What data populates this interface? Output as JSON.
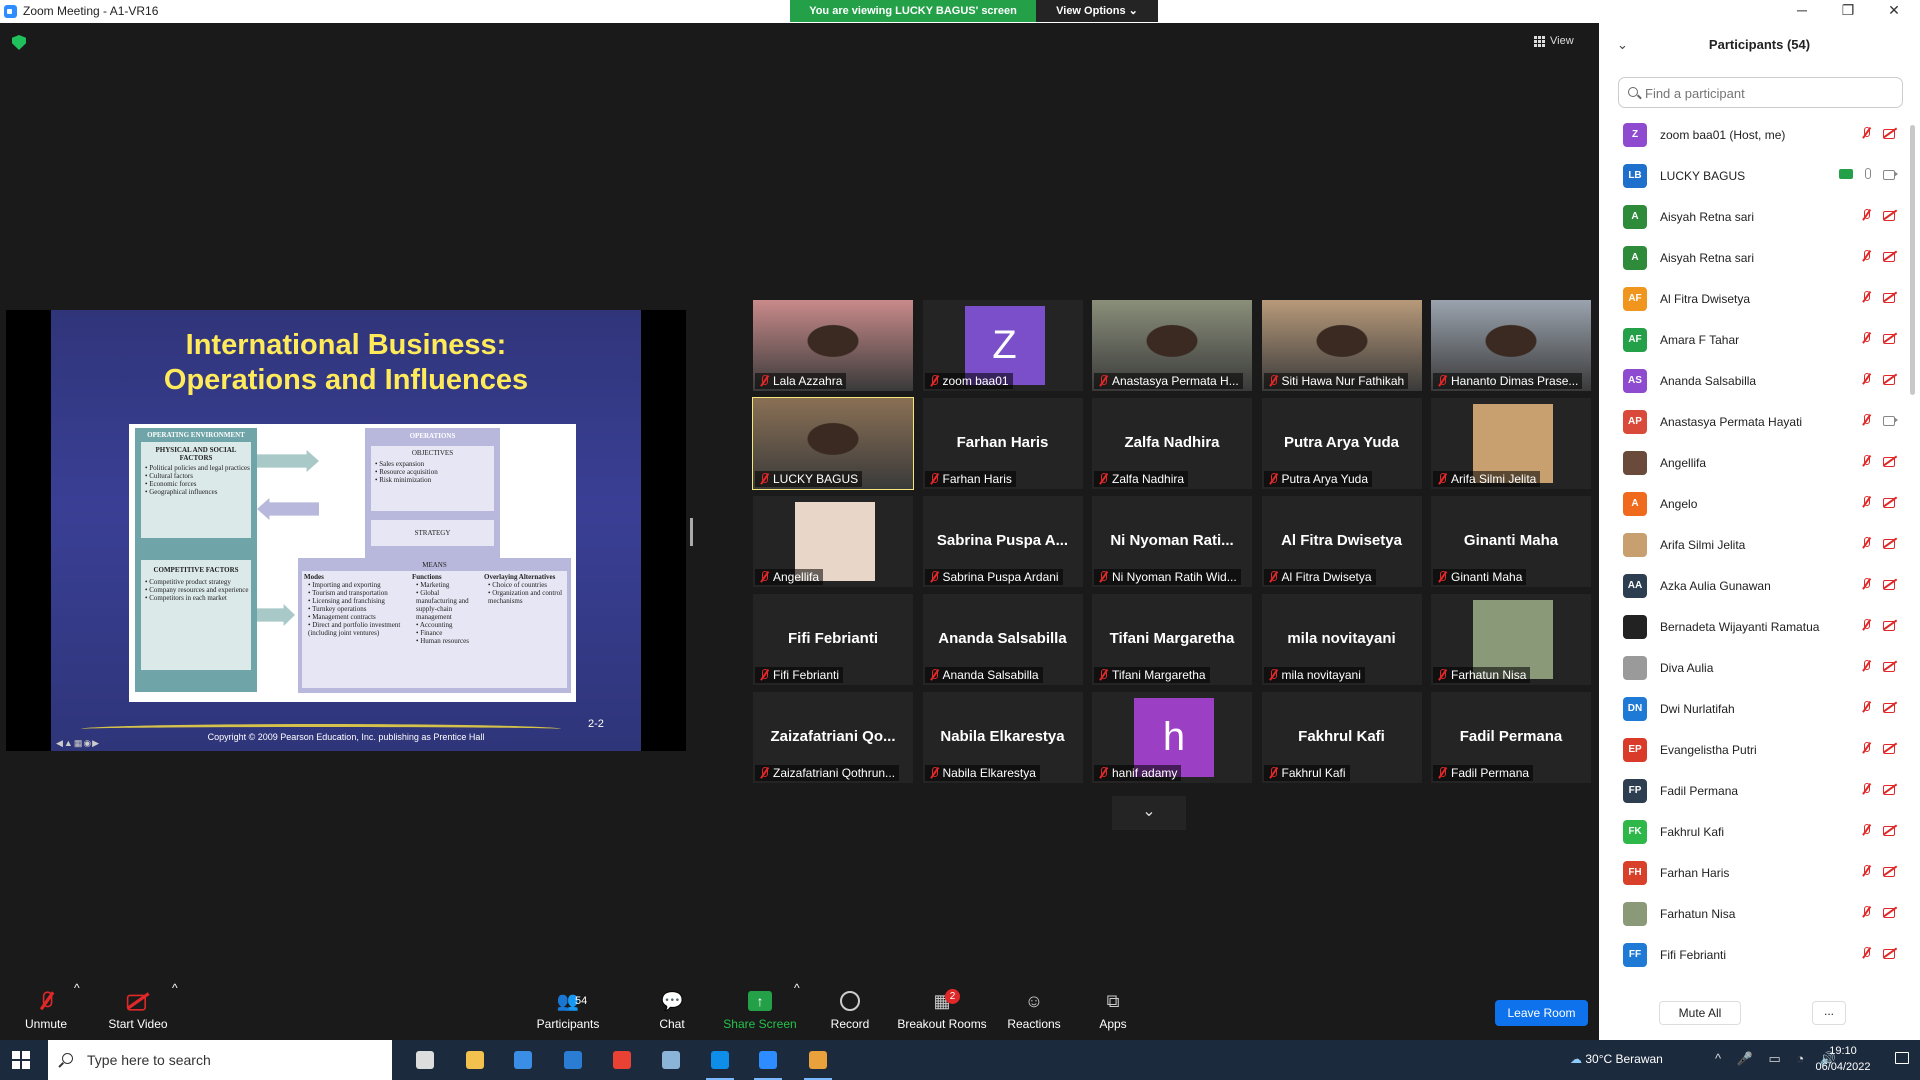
{
  "window": {
    "title": "Zoom Meeting - A1-VR16",
    "minimize": "─",
    "maximize": "❐",
    "close": "✕"
  },
  "banner": {
    "viewing": "You are viewing LUCKY BAGUS' screen",
    "view_options": "View Options ⌄"
  },
  "view_button": "View",
  "shared_slide": {
    "title_line1": "International Business:",
    "title_line2": "Operations and Influences",
    "operating_environment": "OPERATING ENVIRONMENT",
    "physical_social": "PHYSICAL AND SOCIAL FACTORS",
    "physical_items": [
      "Political policies and legal practices",
      "Cultural factors",
      "Economic forces",
      "Geographical influences"
    ],
    "competitive": "COMPETITIVE FACTORS",
    "competitive_items": [
      "Competitive product strategy",
      "Company resources and experience",
      "Competitors in each market"
    ],
    "operations": "OPERATIONS",
    "objectives": "OBJECTIVES",
    "objective_items": [
      "Sales expansion",
      "Resource acquisition",
      "Risk minimization"
    ],
    "strategy": "STRATEGY",
    "means": "MEANS",
    "modes": "Modes",
    "mode_items": [
      "Importing and exporting",
      "Tourism and transportation",
      "Licensing and franchising",
      "Turnkey operations",
      "Management contracts",
      "Direct and portfolio investment (including joint ventures)"
    ],
    "functions": "Functions",
    "function_items": [
      "Marketing",
      "Global manufacturing and supply-chain management",
      "Accounting",
      "Finance",
      "Human resources"
    ],
    "overlaying": "Overlaying Alternatives",
    "overlaying_items": [
      "Choice of countries",
      "Organization and control mechanisms"
    ],
    "slide_number": "2-2",
    "copyright": "Copyright © 2009 Pearson Education, Inc. publishing as Prentice Hall"
  },
  "video_tiles": [
    {
      "name": "Lala Azzahra",
      "type": "photo",
      "color": "#c98a8a"
    },
    {
      "name": "zoom baa01",
      "type": "letter",
      "letter": "Z",
      "color": "#7b4fc9"
    },
    {
      "name": "Anastasya Permata H...",
      "type": "photo",
      "color": "#8a8f7a"
    },
    {
      "name": "Siti Hawa Nur Fathikah",
      "type": "photo",
      "color": "#b89a7a"
    },
    {
      "name": "Hananto Dimas Prase...",
      "type": "photo",
      "color": "#9aa3ae"
    },
    {
      "name": "LUCKY BAGUS",
      "type": "photo",
      "color": "#8a7055",
      "active": true
    },
    {
      "name": "Farhan Haris",
      "type": "name",
      "display": "Farhan Haris"
    },
    {
      "name": "Zalfa Nadhira",
      "type": "name",
      "display": "Zalfa Nadhira"
    },
    {
      "name": "Putra Arya Yuda",
      "type": "name",
      "display": "Putra Arya Yuda"
    },
    {
      "name": "Arifa Silmi Jelita",
      "type": "photo-small",
      "color": "#c8a070"
    },
    {
      "name": "Angellifa",
      "type": "photo-small",
      "color": "#e8d6c8"
    },
    {
      "name": "Sabrina Puspa Ardani",
      "type": "name",
      "display": "Sabrina Puspa A..."
    },
    {
      "name": "Ni Nyoman Ratih Wid...",
      "type": "name",
      "display": "Ni Nyoman Rati..."
    },
    {
      "name": "Al Fitra Dwisetya",
      "type": "name",
      "display": "Al Fitra Dwisetya"
    },
    {
      "name": "Ginanti Maha",
      "type": "name",
      "display": "Ginanti Maha"
    },
    {
      "name": "Fifi Febrianti",
      "type": "name",
      "display": "Fifi Febrianti"
    },
    {
      "name": "Ananda Salsabilla",
      "type": "name",
      "display": "Ananda Salsabilla"
    },
    {
      "name": "Tifani Margaretha",
      "type": "name",
      "display": "Tifani Margaretha"
    },
    {
      "name": "mila novitayani",
      "type": "name",
      "display": "mila novitayani"
    },
    {
      "name": "Farhatun Nisa",
      "type": "photo-small",
      "color": "#8a9a78"
    },
    {
      "name": "Zaizafatriani Qothrun...",
      "type": "name",
      "display": "Zaizafatriani Qo..."
    },
    {
      "name": "Nabila Elkarestya",
      "type": "name",
      "display": "Nabila Elkarestya"
    },
    {
      "name": "hanif adamy",
      "type": "letter",
      "letter": "h",
      "color": "#9b3fc4"
    },
    {
      "name": "Fakhrul Kafi",
      "type": "name",
      "display": "Fakhrul Kafi"
    },
    {
      "name": "Fadil Permana",
      "type": "name",
      "display": "Fadil Permana"
    }
  ],
  "toolbar": {
    "unmute": "Unmute",
    "start_video": "Start Video",
    "participants": "Participants",
    "participant_count": "54",
    "chat": "Chat",
    "share_screen": "Share Screen",
    "record": "Record",
    "breakout_rooms": "Breakout Rooms",
    "breakout_badge": "2",
    "reactions": "Reactions",
    "apps": "Apps",
    "leave": "Leave Room",
    "accent_green": "#24a148"
  },
  "participants_panel": {
    "title": "Participants (54)",
    "search_placeholder": "Find a participant",
    "items": [
      {
        "initials": "Z",
        "name": "zoom baa01 (Host, me)",
        "color": "#8e4bd0",
        "video": "off",
        "mic": "off"
      },
      {
        "initials": "LB",
        "name": "LUCKY BAGUS",
        "color": "#1f6fcc",
        "video": "on",
        "mic": "on",
        "sharing": true
      },
      {
        "initials": "A",
        "name": "Aisyah Retna sari",
        "color": "#2e8b3a",
        "video": "off",
        "mic": "off"
      },
      {
        "initials": "A",
        "name": "Aisyah Retna sari",
        "color": "#2e8b3a",
        "video": "off",
        "mic": "off"
      },
      {
        "initials": "AF",
        "name": "Al Fitra Dwisetya",
        "color": "#f0961e",
        "video": "off",
        "mic": "off"
      },
      {
        "initials": "AF",
        "name": "Amara F Tahar",
        "color": "#24a148",
        "video": "off",
        "mic": "off"
      },
      {
        "initials": "AS",
        "name": "Ananda Salsabilla",
        "color": "#8e4bd0",
        "video": "off",
        "mic": "off"
      },
      {
        "initials": "AP",
        "name": "Anastasya Permata Hayati",
        "color": "#d94a3a",
        "video": "on",
        "mic": "off"
      },
      {
        "initials": "",
        "name": "Angellifa",
        "color": "#6a4a3a",
        "video": "off",
        "mic": "off"
      },
      {
        "initials": "A",
        "name": "Angelo",
        "color": "#f06a1e",
        "video": "off",
        "mic": "off"
      },
      {
        "initials": "",
        "name": "Arifa Silmi Jelita",
        "color": "#c8a070",
        "video": "off",
        "mic": "off"
      },
      {
        "initials": "AA",
        "name": "Azka Aulia Gunawan",
        "color": "#2c3e50",
        "video": "off",
        "mic": "off"
      },
      {
        "initials": "",
        "name": "Bernadeta Wijayanti Ramatua",
        "color": "#222222",
        "video": "off",
        "mic": "off"
      },
      {
        "initials": "",
        "name": "Diva Aulia",
        "color": "#9a9a9a",
        "video": "off",
        "mic": "off"
      },
      {
        "initials": "DN",
        "name": "Dwi Nurlatifah",
        "color": "#1f7ad6",
        "video": "off",
        "mic": "off"
      },
      {
        "initials": "EP",
        "name": "Evangelistha Putri",
        "color": "#d93a2a",
        "video": "off",
        "mic": "off"
      },
      {
        "initials": "FP",
        "name": "Fadil Permana",
        "color": "#2c3e50",
        "video": "off",
        "mic": "off"
      },
      {
        "initials": "FK",
        "name": "Fakhrul Kafi",
        "color": "#2eb84a",
        "video": "off",
        "mic": "off"
      },
      {
        "initials": "FH",
        "name": "Farhan Haris",
        "color": "#d9402a",
        "video": "off",
        "mic": "off"
      },
      {
        "initials": "",
        "name": "Farhatun Nisa",
        "color": "#8a9a78",
        "video": "off",
        "mic": "off"
      },
      {
        "initials": "FF",
        "name": "Fifi Febrianti",
        "color": "#1f7ad6",
        "video": "off",
        "mic": "off"
      },
      {
        "initials": "",
        "name": "",
        "color": "#f0961e",
        "video": "off",
        "mic": "off"
      }
    ],
    "mute_all": "Mute All",
    "more": "..."
  },
  "taskbar": {
    "search_placeholder": "Type here to search",
    "weather": "30°C Berawan",
    "time": "19:10",
    "date": "06/04/2022",
    "apps": [
      {
        "name": "task-view",
        "color": "#dddddd"
      },
      {
        "name": "file-explorer",
        "color": "#f2c14e"
      },
      {
        "name": "microsoft-store",
        "color": "#3a8ee6"
      },
      {
        "name": "mail",
        "color": "#2b7cd3"
      },
      {
        "name": "chrome",
        "color": "#e94235"
      },
      {
        "name": "notepad",
        "color": "#8ab4d8"
      },
      {
        "name": "teamviewer",
        "color": "#0e8ee9",
        "running": true
      },
      {
        "name": "zoom",
        "color": "#2d8cff",
        "running": true
      },
      {
        "name": "chrome-profile",
        "color": "#e9a23b",
        "running": true
      }
    ]
  }
}
